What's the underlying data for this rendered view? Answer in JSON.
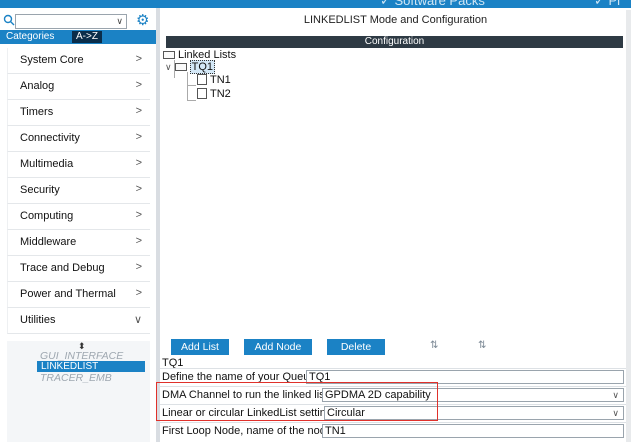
{
  "top_bar": {
    "software_packs": "✓ Software Packs",
    "pinout": "✓ Pi"
  },
  "sidebar": {
    "search": {
      "value": "",
      "placeholder": ""
    },
    "tabs": [
      "Categories",
      "A->Z"
    ],
    "categories": [
      {
        "label": "System Core",
        "arrow": ">"
      },
      {
        "label": "Analog",
        "arrow": ">"
      },
      {
        "label": "Timers",
        "arrow": ">"
      },
      {
        "label": "Connectivity",
        "arrow": ">"
      },
      {
        "label": "Multimedia",
        "arrow": ">"
      },
      {
        "label": "Security",
        "arrow": ">"
      },
      {
        "label": "Computing",
        "arrow": ">"
      },
      {
        "label": "Middleware",
        "arrow": ">"
      },
      {
        "label": "Trace and Debug",
        "arrow": ">"
      },
      {
        "label": "Power and Thermal",
        "arrow": ">"
      },
      {
        "label": "Utilities",
        "arrow": "∨"
      }
    ],
    "utilities_items": [
      {
        "label": "GUI_INTERFACE",
        "selected": false
      },
      {
        "label": "LINKEDLIST",
        "selected": true
      },
      {
        "label": "TRACER_EMB",
        "selected": false
      }
    ]
  },
  "main": {
    "title": "LINKEDLIST Mode and Configuration",
    "configuration_header": "Configuration",
    "tree": {
      "root": "Linked Lists",
      "queue": "TQ1",
      "nodes": [
        "TN1",
        "TN2"
      ]
    },
    "buttons": {
      "add_list": "Add List",
      "add_node": "Add Node",
      "delete": "Delete"
    },
    "selected_node_title": "TQ1",
    "params": [
      {
        "label": "Define the name of your Queue",
        "value": "TQ1",
        "dropdown": false
      },
      {
        "label": "DMA Channel to run the linked list",
        "value": "GPDMA 2D capability",
        "dropdown": true
      },
      {
        "label": "Linear or circular LinkedList setting",
        "value": "Circular",
        "dropdown": true
      },
      {
        "label": "First Loop Node, name of the node",
        "value": "TN1",
        "dropdown": false
      }
    ]
  },
  "colors": {
    "accent": "#1b82c5",
    "config_header": "#2e3a44",
    "highlight_box": "#e0312b",
    "az_tab": "#0a2d4a"
  }
}
